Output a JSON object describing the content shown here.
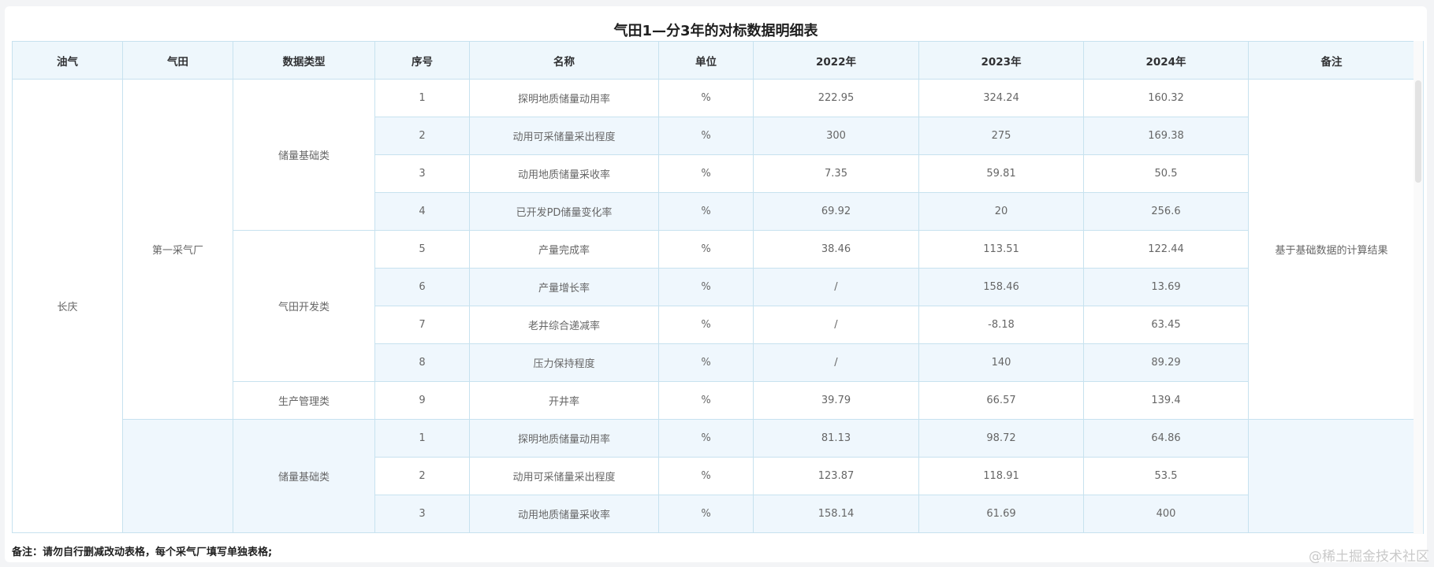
{
  "page": {
    "title": "气田1—分3年的对标数据明细表",
    "footnote": "备注：请勿自行删减改动表格，每个采气厂填写单独表格;",
    "watermark": "@稀土掘金技术社区"
  },
  "table": {
    "headers": [
      "油气",
      "气田",
      "数据类型",
      "序号",
      "名称",
      "单位",
      "2022年",
      "2023年",
      "2024年",
      "备注"
    ],
    "oil_gas": "长庆",
    "field_1": "第一采气厂",
    "remark_1": "基于基础数据的计算结果",
    "groups": {
      "g1": "储量基础类",
      "g2": "气田开发类",
      "g3": "生产管理类",
      "g4": "储量基础类"
    },
    "rows": [
      {
        "no": "1",
        "name": "探明地质储量动用率",
        "unit": "%",
        "y2022": "222.95",
        "y2023": "324.24",
        "y2024": "160.32"
      },
      {
        "no": "2",
        "name": "动用可采储量采出程度",
        "unit": "%",
        "y2022": "300",
        "y2023": "275",
        "y2024": "169.38"
      },
      {
        "no": "3",
        "name": "动用地质储量采收率",
        "unit": "%",
        "y2022": "7.35",
        "y2023": "59.81",
        "y2024": "50.5"
      },
      {
        "no": "4",
        "name": "已开发PD储量变化率",
        "unit": "%",
        "y2022": "69.92",
        "y2023": "20",
        "y2024": "256.6"
      },
      {
        "no": "5",
        "name": "产量完成率",
        "unit": "%",
        "y2022": "38.46",
        "y2023": "113.51",
        "y2024": "122.44"
      },
      {
        "no": "6",
        "name": "产量增长率",
        "unit": "%",
        "y2022": "/",
        "y2023": "158.46",
        "y2024": "13.69"
      },
      {
        "no": "7",
        "name": "老井综合递减率",
        "unit": "%",
        "y2022": "/",
        "y2023": "-8.18",
        "y2024": "63.45"
      },
      {
        "no": "8",
        "name": "压力保持程度",
        "unit": "%",
        "y2022": "/",
        "y2023": "140",
        "y2024": "89.29"
      },
      {
        "no": "9",
        "name": "开井率",
        "unit": "%",
        "y2022": "39.79",
        "y2023": "66.57",
        "y2024": "139.4"
      },
      {
        "no": "1",
        "name": "探明地质储量动用率",
        "unit": "%",
        "y2022": "81.13",
        "y2023": "98.72",
        "y2024": "64.86"
      },
      {
        "no": "2",
        "name": "动用可采储量采出程度",
        "unit": "%",
        "y2022": "123.87",
        "y2023": "118.91",
        "y2024": "53.5"
      },
      {
        "no": "3",
        "name": "动用地质储量采收率",
        "unit": "%",
        "y2022": "158.14",
        "y2023": "61.69",
        "y2024": "400"
      }
    ]
  }
}
